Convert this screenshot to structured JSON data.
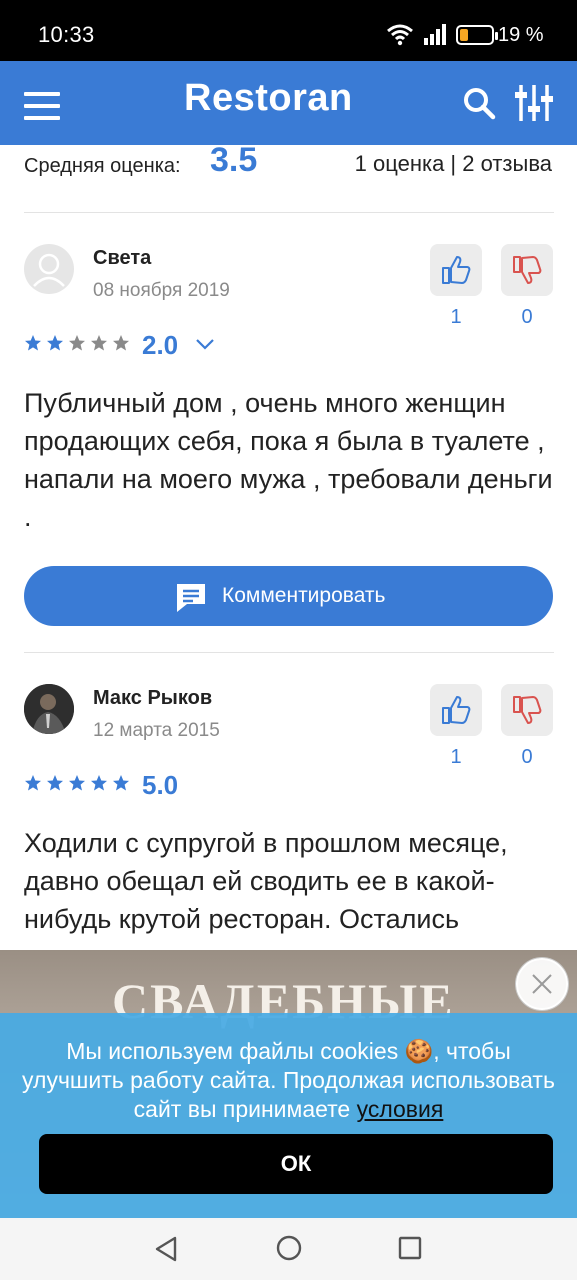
{
  "status_bar": {
    "time": "10:33",
    "battery": "19 %",
    "icons": [
      "wifi-icon",
      "signal-icon",
      "battery-icon"
    ]
  },
  "header": {
    "logo": "Restoran",
    "icons": [
      "menu-icon",
      "search-icon",
      "filter-icon"
    ],
    "background_color": "#3a7bd5"
  },
  "summary": {
    "avg_label": "Средняя оценка:",
    "avg_value": "3.5",
    "counts": "1 оценка | 2 отзыва"
  },
  "reviews": [
    {
      "author": "Света",
      "date": "08 ноября 2019",
      "rating": "2.0",
      "stars_filled": 2,
      "likes": "1",
      "dislikes": "0",
      "text": "Публичный дом , очень много женщин продающих себя, пока я была в туалете , напали на моего мужа , требовали деньги ."
    },
    {
      "author": "Макс Рыков",
      "date": "12 марта 2015",
      "rating": "5.0",
      "stars_filled": 5,
      "likes": "1",
      "dislikes": "0",
      "text": "Ходили с супругой в прошлом месяце, давно обещал ей сводить ее в какой-нибудь крутой ресторан. Остались"
    }
  ],
  "comment_button": {
    "label": "Комментировать"
  },
  "ad": {
    "title": "СВАДЕБНЫЕ"
  },
  "cookie_notice": {
    "message": "Мы используем файлы cookies 🍪, чтобы улучшить работу сайта. Продолжая использовать сайт вы принимаете ",
    "link": "условия",
    "ok_label": "ОК",
    "background_color": "#47aae3"
  },
  "colors": {
    "accent": "#3a7bd5",
    "dislike": "#d9534f",
    "star_empty": "#8a8a8a"
  }
}
